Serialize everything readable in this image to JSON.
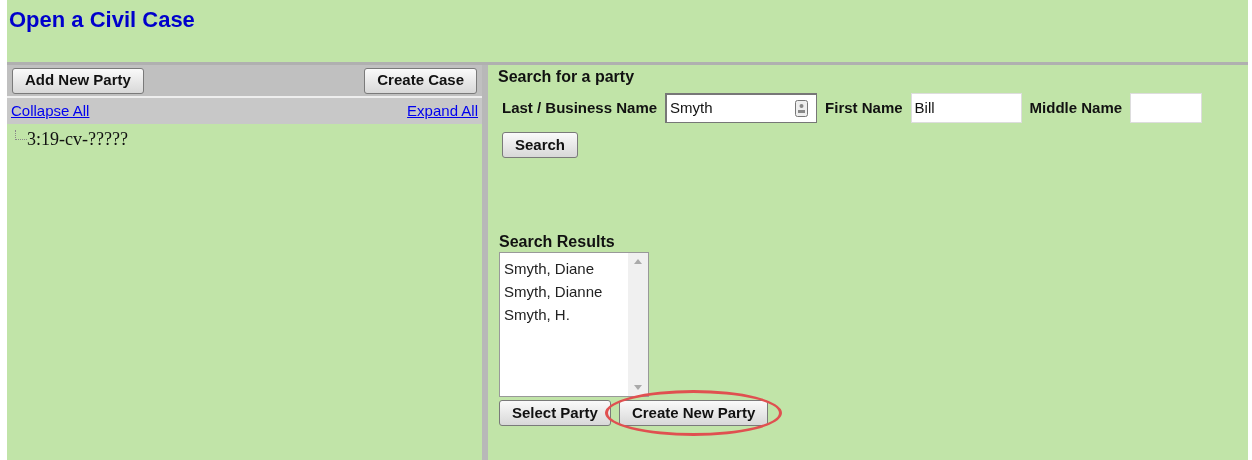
{
  "title": "Open a Civil Case",
  "left_panel": {
    "buttons": [
      "Add New Party",
      "Create Case"
    ],
    "links": [
      "Collapse All",
      "Expand All"
    ],
    "tree": [
      {
        "label": "3:19-cv-?????"
      }
    ]
  },
  "search": {
    "heading": "Search for a party",
    "fields": [
      {
        "label": "Last / Business Name",
        "value": "Smyth",
        "kind": "contact"
      },
      {
        "label": "First Name",
        "value": "Bill",
        "kind": "plain"
      },
      {
        "label": "Middle Name",
        "kind": "plain"
      }
    ],
    "button": "Search"
  },
  "results": {
    "heading": "Search Results",
    "items": [
      {
        "label": "Smyth, Diane",
        "selected": false
      },
      {
        "label": "Smyth, Dianne",
        "selected": false
      },
      {
        "label": "Smyth, H.",
        "selected": false
      }
    ],
    "buttons": [
      {
        "label": "Select Party",
        "highlighted": false
      },
      {
        "label": "Create New Party",
        "highlighted": true
      }
    ]
  }
}
